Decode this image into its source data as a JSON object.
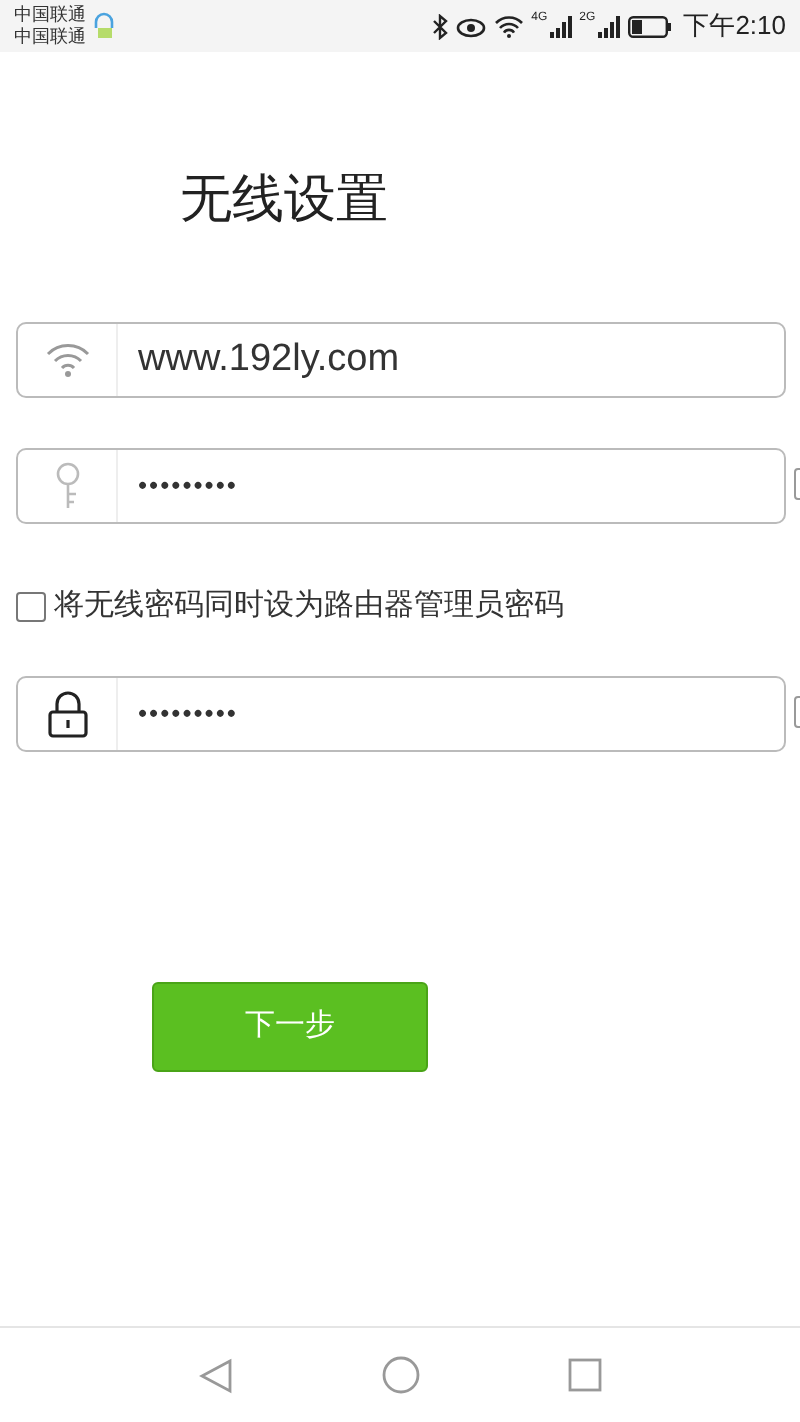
{
  "status_bar": {
    "carriers": [
      "中国联通",
      "中国联通"
    ],
    "network_labels": [
      "4G",
      "2G"
    ],
    "time": "下午2:10"
  },
  "title": "无线设置",
  "fields": [
    {
      "kind": "wifi",
      "value": "www.192ly.com"
    },
    {
      "kind": "key",
      "value": "•••••••••"
    },
    {
      "kind": "checkbox",
      "label": "将无线密码同时设为路由器管理员密码",
      "checked": false
    },
    {
      "kind": "lock",
      "value": "•••••••••"
    }
  ],
  "next_button": "下一步"
}
